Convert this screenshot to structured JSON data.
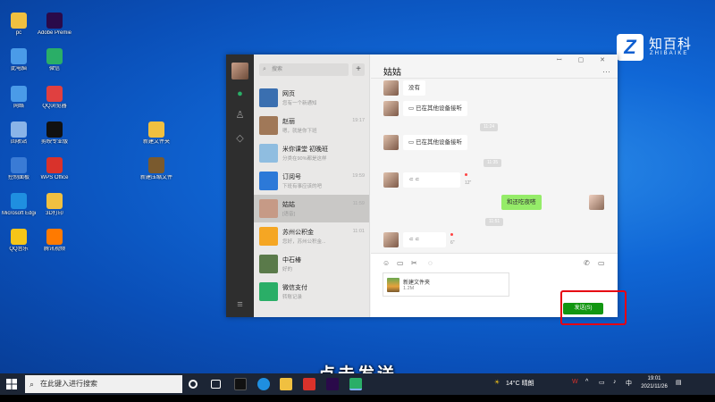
{
  "desktop": {
    "icons": [
      {
        "label": "pc",
        "color": "#f0c040"
      },
      {
        "label": "Adobe Premiere...",
        "color": "#2a0a4a"
      },
      {
        "label": "此电脑",
        "color": "#4a9be8"
      },
      {
        "label": "微信",
        "color": "#2aae67"
      },
      {
        "label": "网络",
        "color": "#4a9be8"
      },
      {
        "label": "QQ浏览器",
        "color": "#e04040"
      },
      {
        "label": "回收站",
        "color": "#8ab4e8"
      },
      {
        "label": "剪映专业版",
        "color": "#111111"
      },
      {
        "label": "控制面板",
        "color": "#3a7bd5"
      },
      {
        "label": "WPS Office",
        "color": "#d9322b"
      },
      {
        "label": "Microsoft Edge",
        "color": "#1f8fe0"
      },
      {
        "label": "3D打印",
        "color": "#f0c040"
      },
      {
        "label": "QQ音乐",
        "color": "#f5c518"
      },
      {
        "label": "腾讯视频",
        "color": "#ff7a00"
      },
      {
        "label": "新建文件夹",
        "color": "#f0c040"
      },
      {
        "label": "新建压缩文件",
        "color": "#7a5a2e"
      }
    ]
  },
  "watermark": {
    "logo": "Z",
    "title": "知百科",
    "subtitle": "ZHIBAIKE"
  },
  "wechat": {
    "search_placeholder": "搜索",
    "plus_label": "+",
    "chat_title": "姑姑",
    "window_controls": "ꟷ ▢ ✕",
    "more_label": "···",
    "conversations": [
      {
        "name": "网页",
        "preview": "您有一个新通知",
        "time": "",
        "color": "#3a6fb0"
      },
      {
        "name": "赵丽",
        "preview": "嗯，就是你下班",
        "time": "19:17",
        "color": "#a07858"
      },
      {
        "name": "米你课堂 初晚班",
        "preview": "分类在90%都是这样",
        "time": "",
        "color": "#8fbde0"
      },
      {
        "name": "订阅号",
        "preview": "下班有事应该的吧",
        "time": "19:59",
        "color": "#2c79d8"
      },
      {
        "name": "姑姑",
        "preview": "[语音]",
        "time": "11:59",
        "color": "#c69a86"
      },
      {
        "name": "苏州公积金",
        "preview": "您好，苏州公积金...",
        "time": "11:01",
        "color": "#f5a623"
      },
      {
        "name": "中石椿",
        "preview": "好的",
        "time": "",
        "color": "#5a7a4a"
      },
      {
        "name": "微信支付",
        "preview": "转账记录",
        "time": "",
        "color": "#2aae67"
      }
    ],
    "messages": {
      "m1": "没有",
      "m2": "已在其他设备接听",
      "ts1": "11:24",
      "m3": "已在其他设备接听",
      "ts2": "11:35",
      "voice1_dur": "12\"",
      "m4": "和还吃夜嗒",
      "ts3": "11:51",
      "voice2_dur": "6\""
    },
    "file": {
      "name": "新建文件夹",
      "size": "1.2M"
    },
    "send_label": "发送(S)"
  },
  "subtitle": "点击发送",
  "taskbar": {
    "search_placeholder": "在此键入进行搜索",
    "weather": "14°C 晴朗",
    "ime": "中",
    "time": "19:01",
    "date": "2021/11/26"
  }
}
